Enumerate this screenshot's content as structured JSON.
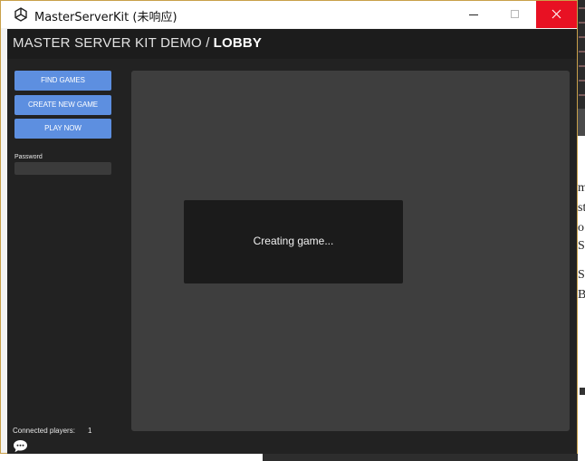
{
  "window": {
    "title": "MasterServerKit (未响应)",
    "accent_close": "#e81123"
  },
  "header": {
    "section": "MASTER SERVER KIT DEMO /",
    "page": "LOBBY"
  },
  "sidebar": {
    "find_games_label": "FIND GAMES",
    "create_game_label": "CREATE NEW GAME",
    "play_now_label": "PLAY NOW",
    "password_label": "Password",
    "password_value": "",
    "button_color": "#5d8fe0"
  },
  "dialog": {
    "message": "Creating game..."
  },
  "footer": {
    "connected_label": "Connected players:",
    "connected_count": "1",
    "chat_icon": "chat-bubble-icon"
  },
  "background": {
    "doc_fragments": [
      "m",
      "st",
      "o",
      "S",
      "S",
      "B"
    ]
  }
}
